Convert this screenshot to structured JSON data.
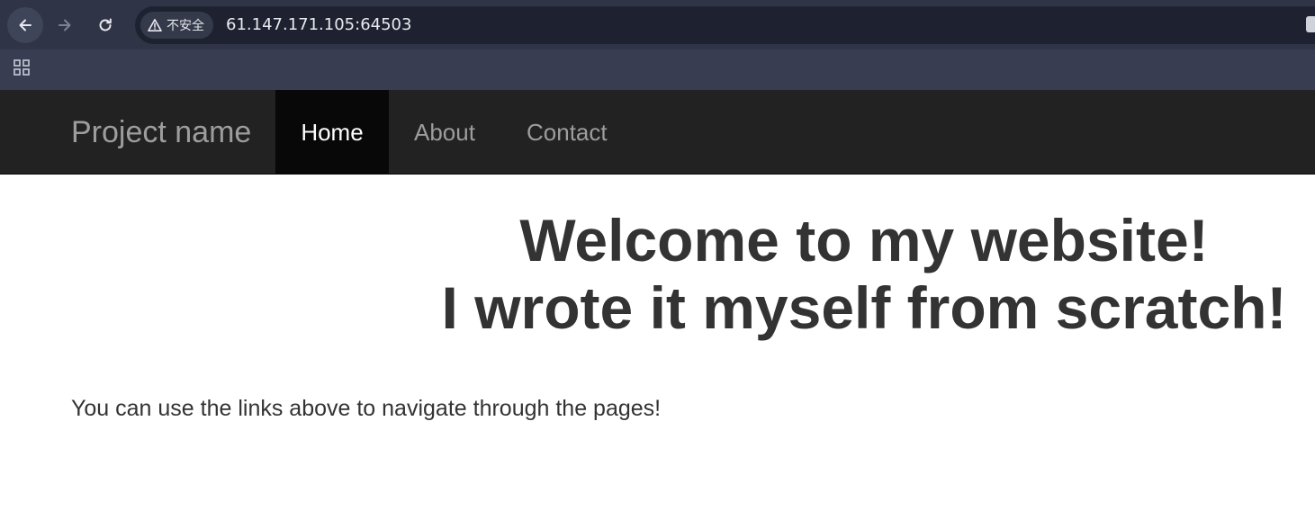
{
  "browser": {
    "security_label": "不安全",
    "url": "61.147.171.105:64503",
    "icons": [
      "back-arrow-icon",
      "forward-arrow-icon",
      "reload-icon",
      "warning-icon",
      "apps-grid-icon"
    ]
  },
  "navbar": {
    "brand": "Project name",
    "items": [
      {
        "label": "Home",
        "active": true
      },
      {
        "label": "About",
        "active": false
      },
      {
        "label": "Contact",
        "active": false
      }
    ]
  },
  "content": {
    "heading_line1": "Welcome to my website!",
    "heading_line2": "I wrote it myself from scratch!",
    "lead": "You can use the links above to navigate through the pages!"
  },
  "colors": {
    "navbar_bg": "#222222",
    "active_nav_bg": "#080808",
    "nav_text": "#9d9d9d",
    "body_text": "#333333",
    "chrome_bg": "#2f3446"
  }
}
